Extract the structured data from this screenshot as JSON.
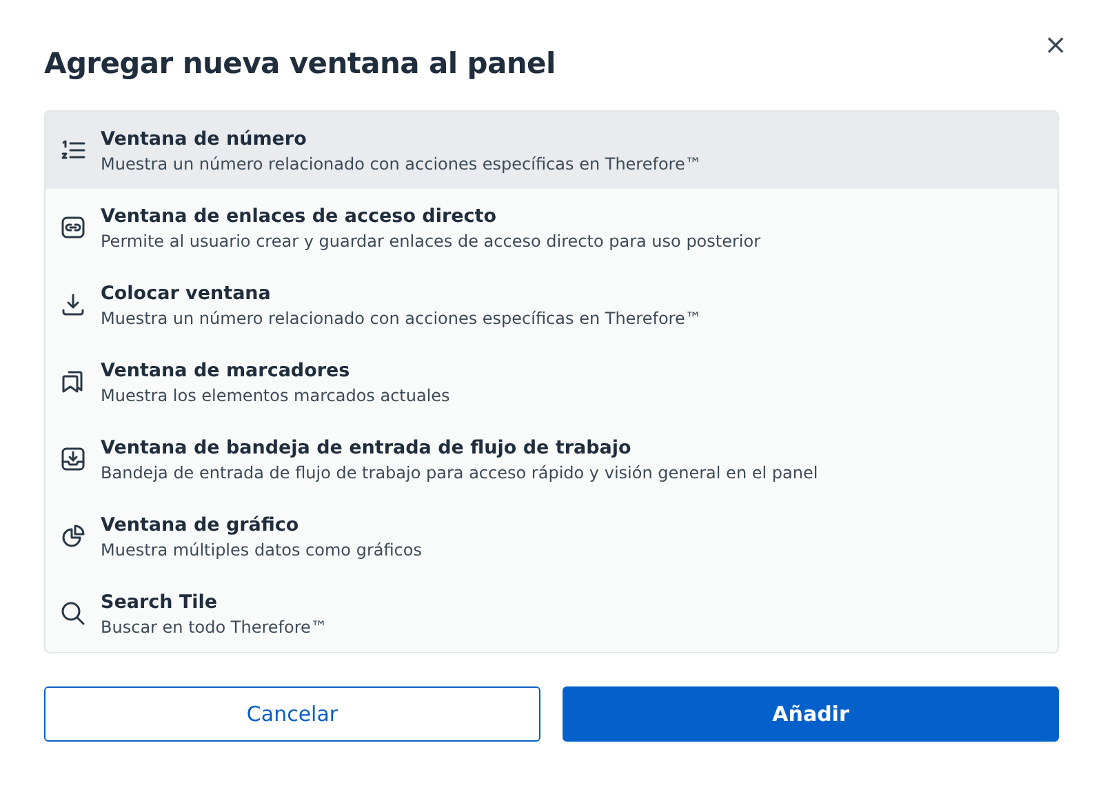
{
  "dialog": {
    "title": "Agregar nueva ventana al panel",
    "close": "×"
  },
  "tiles": [
    {
      "kind": "number",
      "title": "Ventana de número",
      "description": "Muestra un número relacionado con acciones específicas en Therefore™",
      "selected": true
    },
    {
      "kind": "link",
      "title": "Ventana de enlaces de acceso directo",
      "description": "Permite al usuario crear y guardar enlaces de acceso directo para uso posterior",
      "selected": false
    },
    {
      "kind": "download",
      "title": "Colocar ventana",
      "description": "Muestra un número relacionado con acciones específicas en Therefore™",
      "selected": false
    },
    {
      "kind": "bookmark",
      "title": "Ventana de marcadores",
      "description": "Muestra los elementos marcados actuales",
      "selected": false
    },
    {
      "kind": "inbox",
      "title": "Ventana de bandeja de entrada de flujo de trabajo",
      "description": "Bandeja de entrada de flujo de trabajo para acceso rápido y visión general en el panel",
      "selected": false
    },
    {
      "kind": "chart",
      "title": "Ventana de gráfico",
      "description": "Muestra múltiples datos como gráficos",
      "selected": false
    },
    {
      "kind": "search",
      "title": "Search Tile",
      "description": "Buscar en todo Therefore™",
      "selected": false
    }
  ],
  "buttons": {
    "cancel": "Cancelar",
    "add": "Añadir"
  }
}
